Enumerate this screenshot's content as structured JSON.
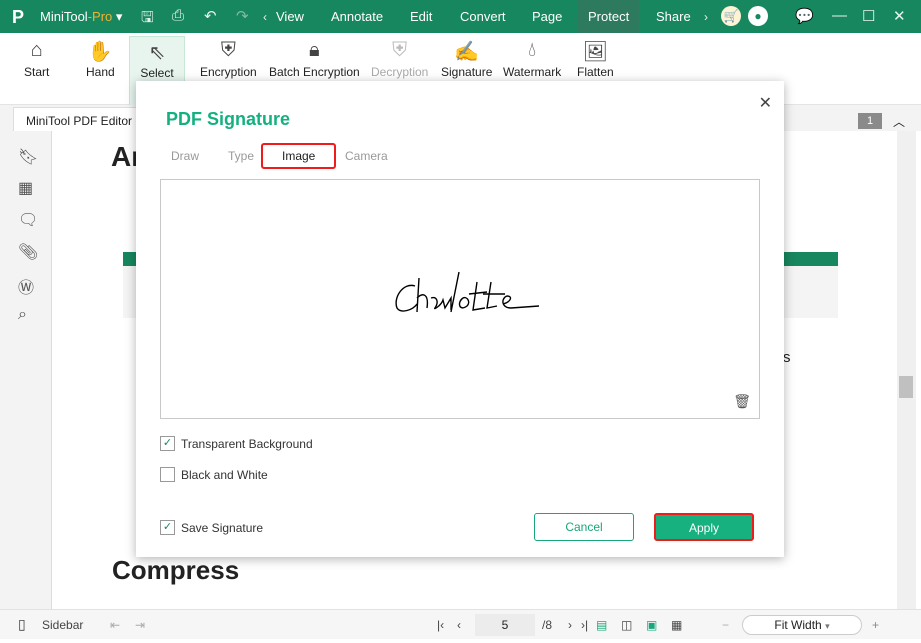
{
  "app": {
    "name": "MiniTool",
    "edition": "-Pro"
  },
  "menu": [
    "View",
    "Annotate",
    "Edit",
    "Convert",
    "Page",
    "Protect",
    "Share"
  ],
  "active_menu": "Protect",
  "ribbon": [
    {
      "label": "Start",
      "icon": "home-icon"
    },
    {
      "label": "Hand",
      "icon": "hand-icon"
    },
    {
      "label": "Select",
      "icon": "cursor-icon"
    },
    {
      "label": "Encryption",
      "icon": "shield-lock-icon"
    },
    {
      "label": "Batch Encryption",
      "icon": "lock-icon"
    },
    {
      "label": "Decryption",
      "icon": "shield-key-icon",
      "disabled": true
    },
    {
      "label": "Signature",
      "icon": "signature-icon"
    },
    {
      "label": "Watermark",
      "icon": "watermark-icon"
    },
    {
      "label": "Flatten",
      "icon": "flatten-icon"
    }
  ],
  "doc_tab": "MiniTool PDF Editor U",
  "page_badge": "1",
  "doc": {
    "heading_top": "Ar",
    "heading_bottom": "Compress",
    "side_char": "s"
  },
  "dialog": {
    "title": "PDF Signature",
    "tabs": [
      "Draw",
      "Type",
      "Image",
      "Camera"
    ],
    "active_tab": "Image",
    "signature_text": "Charlotte",
    "options": [
      {
        "label": "Transparent Background",
        "checked": true
      },
      {
        "label": "Black and White",
        "checked": false
      }
    ],
    "save_signature": {
      "label": "Save Signature",
      "checked": true
    },
    "cancel": "Cancel",
    "apply": "Apply"
  },
  "status": {
    "sidebar": "Sidebar",
    "page": "5",
    "total": "/8",
    "zoom": "Fit Width"
  },
  "colors": {
    "brand": "#17875f",
    "accent": "#17b07f",
    "highlight": "#f01c1c"
  }
}
